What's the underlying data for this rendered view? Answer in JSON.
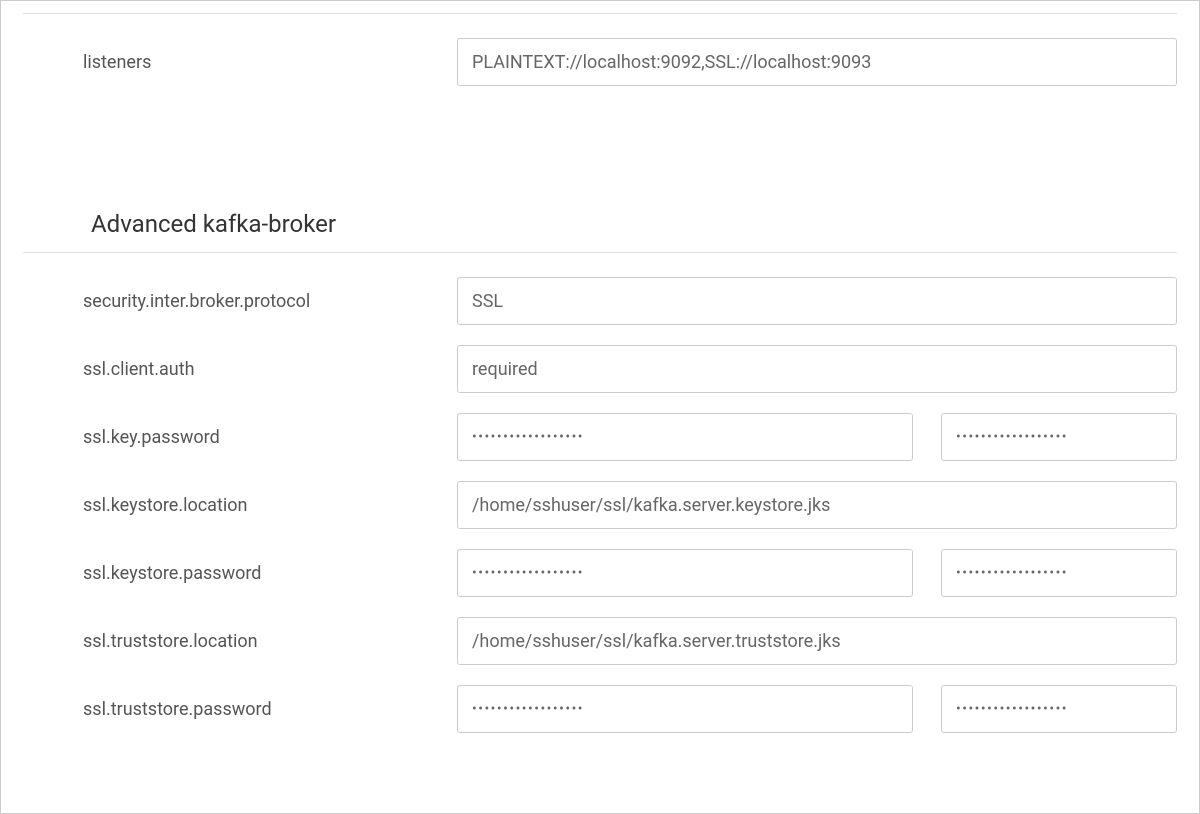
{
  "top_row": {
    "label": "listeners",
    "value": "PLAINTEXT://localhost:9092,SSL://localhost:9093"
  },
  "section": {
    "title": "Advanced kafka-broker"
  },
  "rows": [
    {
      "label": "security.inter.broker.protocol",
      "value": "SSL",
      "type": "text"
    },
    {
      "label": "ssl.client.auth",
      "value": "required",
      "type": "text"
    },
    {
      "label": "ssl.key.password",
      "value": "••••••••••••••••••",
      "value2": "••••••••••••••••••",
      "type": "password-pair"
    },
    {
      "label": "ssl.keystore.location",
      "value": "/home/sshuser/ssl/kafka.server.keystore.jks",
      "type": "text"
    },
    {
      "label": "ssl.keystore.password",
      "value": "••••••••••••••••••",
      "value2": "••••••••••••••••••",
      "type": "password-pair"
    },
    {
      "label": "ssl.truststore.location",
      "value": "/home/sshuser/ssl/kafka.server.truststore.jks",
      "type": "text"
    },
    {
      "label": "ssl.truststore.password",
      "value": "••••••••••••••••••",
      "value2": "••••••••••••••••••",
      "type": "password-pair"
    }
  ]
}
